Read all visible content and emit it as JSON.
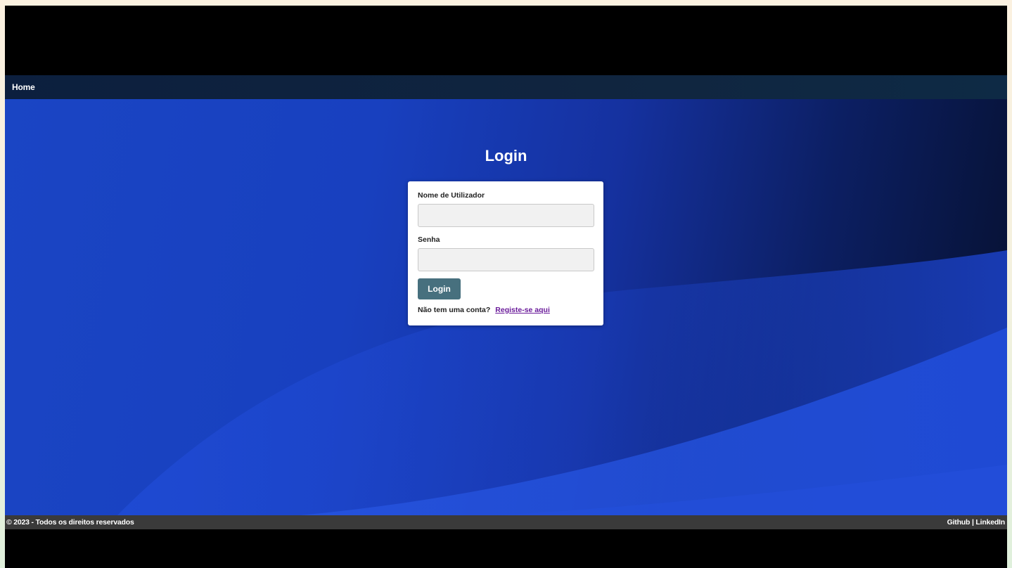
{
  "navbar": {
    "home_label": "Home"
  },
  "login": {
    "title": "Login",
    "username_label": "Nome de Utilizador",
    "username_value": "",
    "password_label": "Senha",
    "password_value": "",
    "submit_label": "Login",
    "no_account_text": "Não tem uma conta?",
    "register_link": "Registe-se aqui"
  },
  "footer": {
    "copyright": "© 2023 - Todos os direitos reservados",
    "github_label": "Github",
    "separator": "|",
    "linkedin_label": "LinkedIn"
  },
  "colors": {
    "navbar": "#10253f",
    "hero_light": "#1a45c4",
    "hero_dark": "#06102e",
    "login_button": "#47707e",
    "register_link": "#6a1b9a",
    "footer": "#3a3a3a"
  }
}
